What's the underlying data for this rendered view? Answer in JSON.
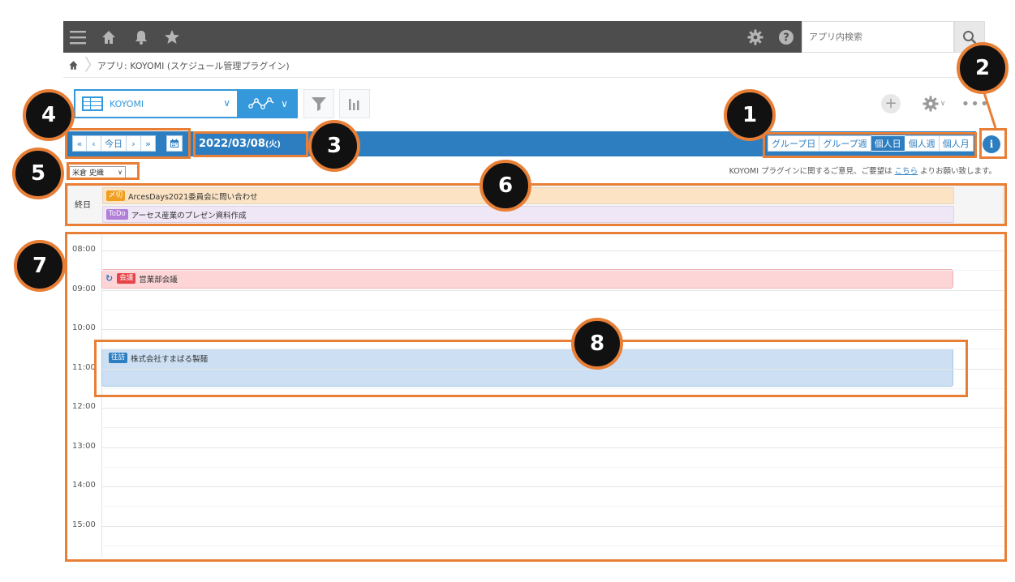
{
  "search": {
    "placeholder": "アプリ内検索"
  },
  "breadcrumb": {
    "text": "アプリ: KOYOMI (スケジュール管理プラグイン)"
  },
  "view": {
    "name": "KOYOMI"
  },
  "nav": {
    "first": "«",
    "prev": "‹",
    "today": "今日",
    "next": "›",
    "last": "»"
  },
  "date_title": "2022/03/08",
  "date_weekday": "(火)",
  "modes": [
    {
      "label": "グループ日",
      "active": false
    },
    {
      "label": "グループ週",
      "active": false
    },
    {
      "label": "個人日",
      "active": true
    },
    {
      "label": "個人週",
      "active": false
    },
    {
      "label": "個人月",
      "active": false
    }
  ],
  "user_select": {
    "value": "米倉 史織"
  },
  "feedback": {
    "prefix": "KOYOMI プラグインに関するご意見、ご要望は ",
    "link": "こちら",
    "suffix": " よりお願い致します。"
  },
  "allday": {
    "label": "終日",
    "events": [
      {
        "tag": "〆切",
        "tag_color": "#f0a020",
        "bg": "#fbe3c3",
        "title": "ArcesDays2021委員会に問い合わせ"
      },
      {
        "tag": "ToDo",
        "tag_color": "#b17fd8",
        "bg": "#efe6f6",
        "title": "アーセス産業のプレゼン資料作成"
      }
    ]
  },
  "times": [
    "08:00",
    "09:00",
    "10:00",
    "11:00",
    "12:00",
    "13:00",
    "14:00",
    "15:00"
  ],
  "events": [
    {
      "tag": "会議",
      "tag_color": "#e8454a",
      "bg": "#fdd5d7",
      "border": "#f3aeb1",
      "title": "営業部会議",
      "repeat": "↻"
    },
    {
      "tag": "往訪",
      "tag_color": "#2d7ec1",
      "bg": "#cde0f3",
      "border": "#a6c6e6",
      "title": "株式会社すまばる製麺"
    }
  ],
  "badges": [
    "1",
    "2",
    "3",
    "4",
    "5",
    "6",
    "7",
    "8"
  ],
  "colors": {
    "accent": "#3498db",
    "nav": "#2d7ec1",
    "annotation": "#e87f36"
  }
}
